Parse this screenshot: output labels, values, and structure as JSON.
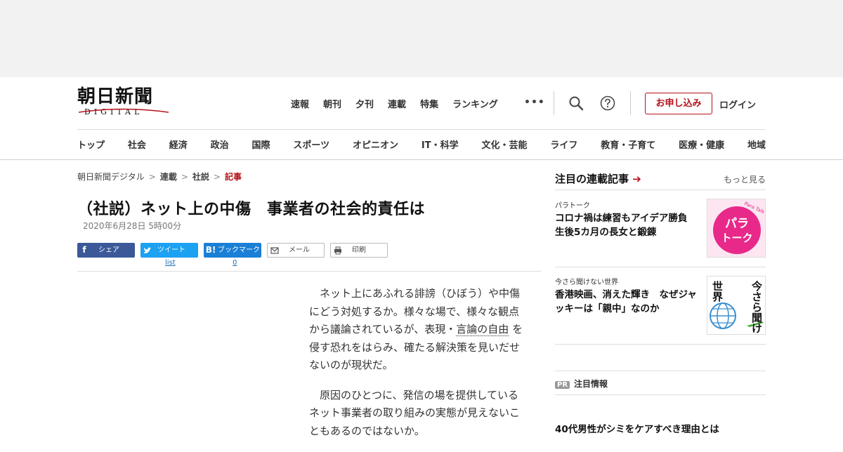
{
  "header": {
    "logo_main": "朝日新聞",
    "logo_sub": "DIGITAL",
    "top_nav": [
      "速報",
      "朝刊",
      "夕刊",
      "連載",
      "特集",
      "ランキング"
    ],
    "more_dots": "•••",
    "signup_label": "お申し込み",
    "login_label": "ログイン",
    "categories": [
      "トップ",
      "社会",
      "経済",
      "政治",
      "国際",
      "スポーツ",
      "オピニオン",
      "IT・科学",
      "文化・芸能",
      "ライフ",
      "教育・子育て",
      "医療・健康",
      "地域"
    ]
  },
  "breadcrumb": {
    "items": [
      "朝日新聞デジタル",
      "連載",
      "社説"
    ],
    "current": "記事",
    "separator": ">"
  },
  "article": {
    "title": "（社説）ネット上の中傷　事業者の社会的責任は",
    "date": "2020年6月28日 5時00分",
    "share": {
      "facebook": "シェア",
      "twitter": "ツイート",
      "hatena": "ブックマーク",
      "hatena_icon": "B!",
      "mail": "メール",
      "print": "印刷",
      "twitter_count": "list",
      "hatena_count": "0"
    },
    "p1_a": "ネット上にあふれる誹謗（ひぼう）や中傷にどう対処するか。様々な場で、様々な観点から議論されているが、表現・",
    "p1_link": "言論の自由",
    "p1_b": "を侵す恐れをはらみ、確たる解決策を見いだせないのが現状だ。",
    "p2": "原因のひとつに、発信の場を提供しているネット事業者の取り組みの実態が見えないこともあるのではないか。"
  },
  "sidebar": {
    "heading": "注目の連載記事",
    "heading_arrow": "➔",
    "more": "もっと見る",
    "items": [
      {
        "category": "パラトーク",
        "title": "コロナ禍は練習もアイデア勝負　生後5カ月の長女と鍛錬",
        "thumb_text_1": "パラ",
        "thumb_text_2": "トーク",
        "thumb_tag": "Para Talk"
      },
      {
        "category": "今さら聞けない世界",
        "title": "香港映画、消えた輝き　なぜジャッキーは「親中」なのか",
        "thumb_text_a": "今さら聞けない",
        "thumb_text_b": "世界"
      }
    ],
    "pr_badge": "PR",
    "pr_heading": "注目情報",
    "pr_title": "40代男性がシミをケアすべき理由とは"
  },
  "colors": {
    "brand_red": "#b3121a",
    "facebook": "#3b5998",
    "twitter": "#1da1f2",
    "hatena": "#1a7fd6",
    "para_pink": "#e8298a"
  }
}
